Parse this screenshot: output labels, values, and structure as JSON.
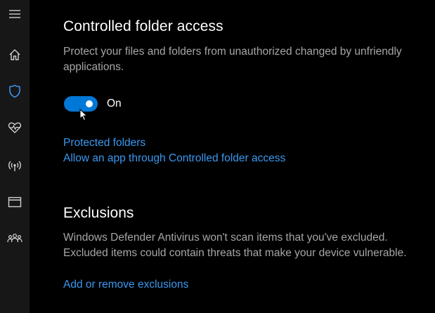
{
  "sidebar": {
    "items": [
      {
        "icon": "hamburger-menu-icon"
      },
      {
        "icon": "home-icon"
      },
      {
        "icon": "shield-icon",
        "active": true
      },
      {
        "icon": "heart-pulse-icon"
      },
      {
        "icon": "network-antenna-icon"
      },
      {
        "icon": "app-browser-window-icon"
      },
      {
        "icon": "family-group-icon"
      }
    ]
  },
  "controlled_folder_access": {
    "title": "Controlled folder access",
    "description": "Protect your files and folders from unauthorized changed by unfriendly applications.",
    "toggle_state": "On",
    "toggle_on": true,
    "links": {
      "protected_folders": "Protected folders",
      "allow_app": "Allow an app through Controlled folder access"
    }
  },
  "exclusions": {
    "title": "Exclusions",
    "description": "Windows Defender Antivirus won't scan items that you've excluded. Excluded items could contain threats that make your device vulnerable.",
    "link": "Add or remove exclusions"
  },
  "colors": {
    "accent": "#0078d7",
    "link": "#3b98f0",
    "background": "#000000",
    "sidebar": "#171717",
    "secondary_text": "#a6a6a6"
  }
}
